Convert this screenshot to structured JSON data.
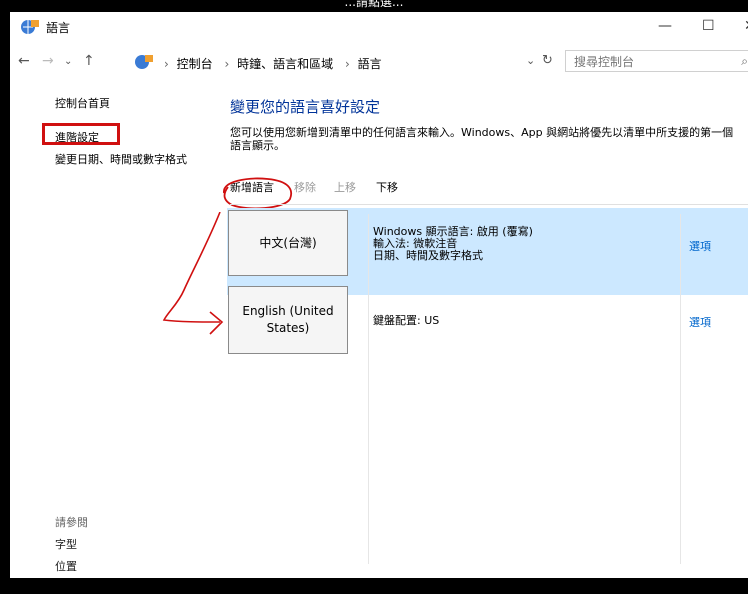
{
  "caption": "...請點選...",
  "window": {
    "title": "語言",
    "controls": {
      "minimize": "—",
      "maximize": "☐",
      "close": "✕"
    }
  },
  "address": {
    "crumbs": [
      "控制台",
      "時鐘、語言和區域",
      "語言"
    ],
    "search_placeholder": "搜尋控制台"
  },
  "left_nav": {
    "items": [
      "控制台首頁",
      "進階設定",
      "變更日期、時間或數字格式"
    ]
  },
  "see_also": {
    "heading": "請參閱",
    "links": [
      "字型",
      "位置"
    ]
  },
  "main": {
    "title": "變更您的語言喜好設定",
    "desc_line1": "您可以使用您新增到清單中的任何語言來輸入。Windows、App 與網站將優先以清單中所支援的第一個",
    "desc_line2": "語言顯示。",
    "toolbar": {
      "add": "新增語言",
      "remove": "移除",
      "up": "上移",
      "down": "下移"
    }
  },
  "languages": [
    {
      "name": "中文(台灣)",
      "info": [
        "Windows 顯示語言: 啟用 (覆寫)",
        "輸入法: 微軟注音",
        "日期、時間及數字格式"
      ],
      "options": "選項",
      "selected": true
    },
    {
      "name_line1": "English (United",
      "name_line2": "States)",
      "info": [
        "鍵盤配置: US"
      ],
      "options": "選項",
      "selected": false
    }
  ],
  "colors": {
    "accent": "#003399",
    "link": "#0066cc",
    "selected_row": "#cce8ff",
    "annotation": "#d01010"
  }
}
